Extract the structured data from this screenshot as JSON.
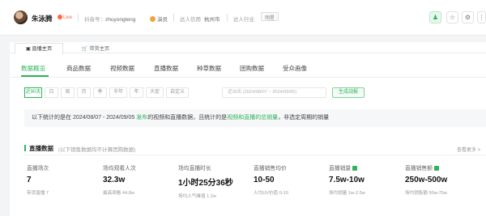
{
  "header": {
    "name": "朱泳腾",
    "live_label": "Live",
    "douyin_id_label": "抖音号：",
    "douyin_id": "zhuyongteng",
    "role": "演员",
    "credit_label": "达人信用",
    "city": "杭州市",
    "industry_label": "达人行业",
    "industry_tag": "明星"
  },
  "panel_tabs": [
    {
      "label": "直播主页"
    },
    {
      "label": "带货主页"
    }
  ],
  "nav": {
    "items": [
      "数据概览",
      "商品数据",
      "视频数据",
      "直播数据",
      "种草数据",
      "团购数据",
      "受众画像"
    ],
    "active_index": 0
  },
  "filters": {
    "chips": [
      "近90天",
      "日",
      "周",
      "月",
      "季",
      "半年",
      "年",
      "大促",
      "自定义"
    ],
    "active_index": 0,
    "date_range": "近30天 (2024/08/07 ~ 2024/09/05)",
    "generate_label": "生成战报"
  },
  "notice": {
    "part1": "以下统计的是在 2024/08/07 - 2024/09/05 ",
    "publish": "发布",
    "part2": "的视频和直播数据，且统计的是",
    "video_live": "视频和直播",
    "total_sales": "的总销量",
    "part3": "，非选定周期的销量"
  },
  "section": {
    "title": "直播数据",
    "subtitle": "(以下销售数据均不计算团购数据)",
    "more": "查看更多 >"
  },
  "stats": [
    {
      "label": "直播场次",
      "value": "7",
      "sub": "带货直播 7"
    },
    {
      "label": "场均观看人次",
      "value": "32.3w",
      "sub": "最高观看 44.8w"
    },
    {
      "label": "场均直播时长",
      "value": "1小时25分36秒",
      "sub": "场均人气峰值 1.2w"
    },
    {
      "label": "直播销售均价",
      "value": "10-50",
      "sub": "人均UV价值 0-10"
    },
    {
      "label": "直播销量",
      "value": "7.5w-10w",
      "sub": "场均销量 1w-2.5w",
      "chart": true
    },
    {
      "label": "直播销售额",
      "value": "250w-500w",
      "sub": "场均销售额 50w-75w",
      "chart": true
    }
  ],
  "colors": {
    "accent": "#2fb45a",
    "live": "#ff6a3d"
  }
}
